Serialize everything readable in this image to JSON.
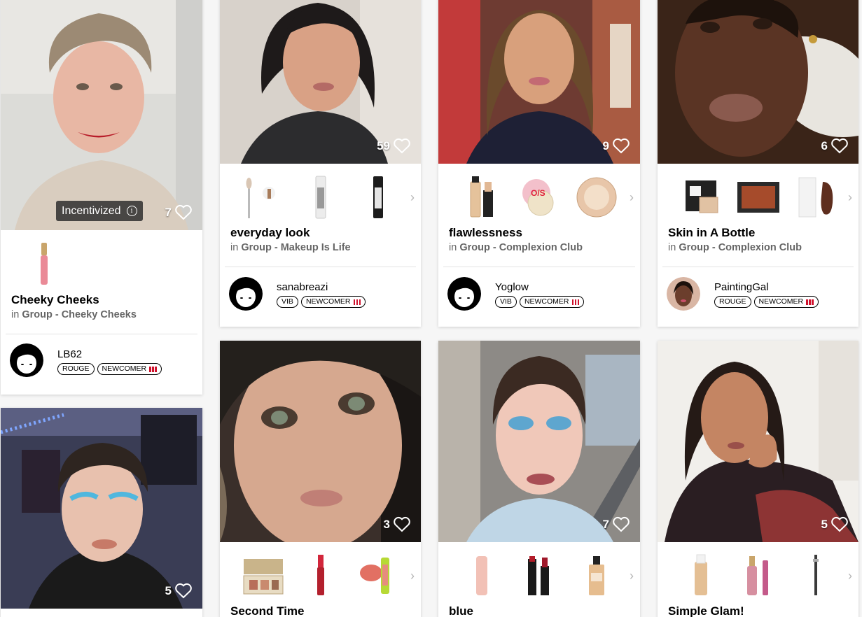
{
  "cards": [
    {
      "title": "Cheeky Cheeks",
      "group_prefix": "in",
      "group": "Group - Cheeky Cheeks",
      "likes": "7",
      "incentivized_label": "Incentivized",
      "user": {
        "name": "LB62",
        "badges": [
          "ROUGE",
          "NEWCOMER"
        ]
      }
    },
    {
      "title": "everyday look",
      "group_prefix": "in",
      "group": "Group - Makeup Is Life",
      "likes": "59",
      "user": {
        "name": "sanabreazi",
        "badges": [
          "VIB",
          "NEWCOMER"
        ]
      }
    },
    {
      "title": "flawlessness",
      "group_prefix": "in",
      "group": "Group - Complexion Club",
      "likes": "9",
      "user": {
        "name": "Yoglow",
        "badges": [
          "VIB",
          "NEWCOMER"
        ]
      }
    },
    {
      "title": "Skin in A Bottle",
      "group_prefix": "in",
      "group": "Group - Complexion Club",
      "likes": "6",
      "user": {
        "name": "PaintingGal",
        "badges": [
          "ROUGE",
          "NEWCOMER"
        ]
      }
    },
    {
      "likes": "5"
    },
    {
      "title": "Second Time",
      "likes": "3"
    },
    {
      "title": "blue",
      "likes": "7"
    },
    {
      "title": "Simple Glam!",
      "likes": "5"
    }
  ],
  "colors": {
    "newcomer_bars": "#cf112c",
    "chevron": "#b5b5b5"
  },
  "icons": {
    "like": "heart-outline-icon",
    "next": "chevron-right-icon",
    "info": "info-icon"
  }
}
